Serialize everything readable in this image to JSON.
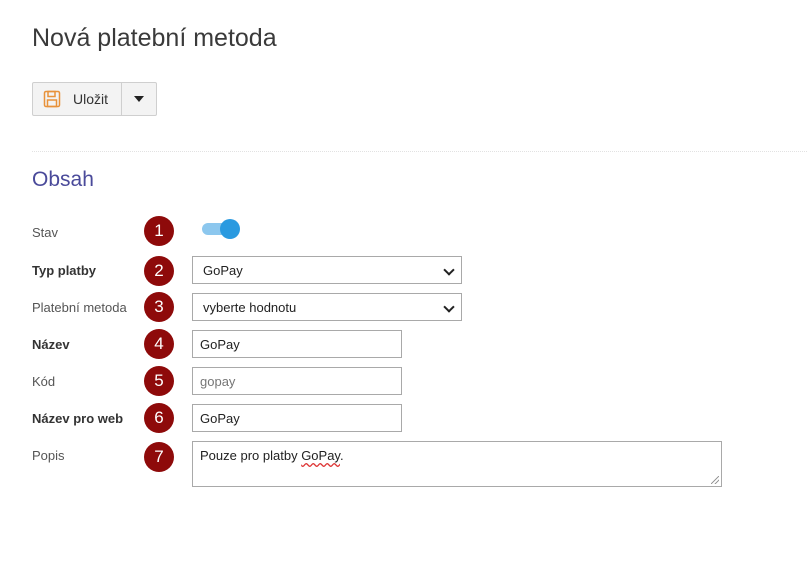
{
  "page": {
    "title": "Nová platební metoda"
  },
  "toolbar": {
    "save_label": "Uložit",
    "save_icon": "floppy-disk-icon",
    "dropdown_icon": "caret-down-icon"
  },
  "section": {
    "title": "Obsah"
  },
  "fields": {
    "stav": {
      "label": "Stav",
      "badge": "1",
      "enabled": true
    },
    "typ_platby": {
      "label": "Typ platby",
      "badge": "2",
      "value": "GoPay"
    },
    "platebni_metoda": {
      "label": "Platební metoda",
      "badge": "3",
      "value": "vyberte hodnotu"
    },
    "nazev": {
      "label": "Název",
      "badge": "4",
      "value": "GoPay"
    },
    "kod": {
      "label": "Kód",
      "badge": "5",
      "placeholder": "gopay"
    },
    "nazev_web": {
      "label": "Název pro web",
      "badge": "6",
      "value": "GoPay"
    },
    "popis": {
      "label": "Popis",
      "badge": "7",
      "value_prefix": "Pouze pro platby ",
      "value_word": "GoPay",
      "value_suffix": "."
    }
  },
  "colors": {
    "accent": "#2a9ae0",
    "section_title": "#4a4a9a",
    "badge": "#8e0a0a",
    "save_icon": "#e8923a"
  }
}
